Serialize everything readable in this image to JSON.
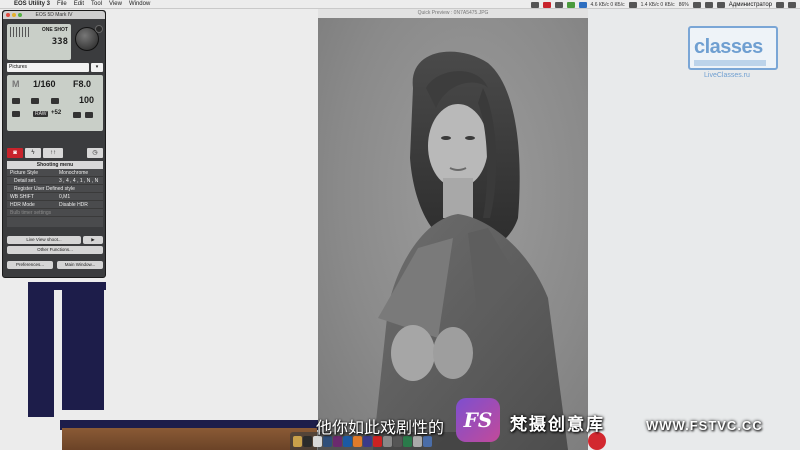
{
  "menubar": {
    "app_name": "EOS Utility 3",
    "menus": [
      "File",
      "Edit",
      "Tool",
      "View",
      "Window"
    ],
    "tray_text_1": "4.6 КБ/с\n0 КБ/с",
    "tray_text_2": "1.4 КБ/с\n0 КБ/с",
    "battery": "86%",
    "user": "Администратор"
  },
  "preview": {
    "title": "Quick Preview : 0N7A5475.JPG"
  },
  "eos": {
    "title": "EOS 5D Mark IV",
    "af_mode": "ONE SHOT",
    "shots_remaining": "338",
    "folder": "Pictures",
    "mode": "M",
    "shutter": "1/160",
    "aperture": "F8.0",
    "iso": "100",
    "quality": "RAW",
    "exp_comp": "+52",
    "toolbar": {
      "camera_glyph": "◙",
      "flash_glyph": "ϟ",
      "settings_glyph": "↑↑",
      "timer_glyph": "◷"
    },
    "shooting_menu": {
      "header": "Shooting menu",
      "rows": [
        {
          "key": "Picture Style",
          "value": "Monochrome"
        },
        {
          "key": "Detail set.",
          "value": "3 , 4 , 4 , 1 , N , N"
        },
        {
          "key": "Register User Defined style",
          "value": ""
        },
        {
          "key": "WB SHIFT",
          "value": "0,M1"
        },
        {
          "key": "HDR Mode",
          "value": "Disable HDR"
        },
        {
          "key": "Bulb timer settings",
          "value": ""
        }
      ]
    },
    "live_view_label": "Live View shoot...",
    "movie_glyph": "▶",
    "other_functions_label": "Other Functions...",
    "preferences_label": "Preferences...",
    "main_window_label": "Main Window..."
  },
  "logo": {
    "word": "classes",
    "site": "LiveClasses.ru"
  },
  "subtitle": "他你如此戏剧性的",
  "watermark": {
    "badge": "FS",
    "name": "梵摄创意库",
    "url": "WWW.FSTVC.CC"
  },
  "colors": {
    "accent_red": "#c8232b",
    "lcd": "#c9cfc8",
    "panel": "#3b3c3e",
    "logo_blue": "#6f9fd1"
  }
}
